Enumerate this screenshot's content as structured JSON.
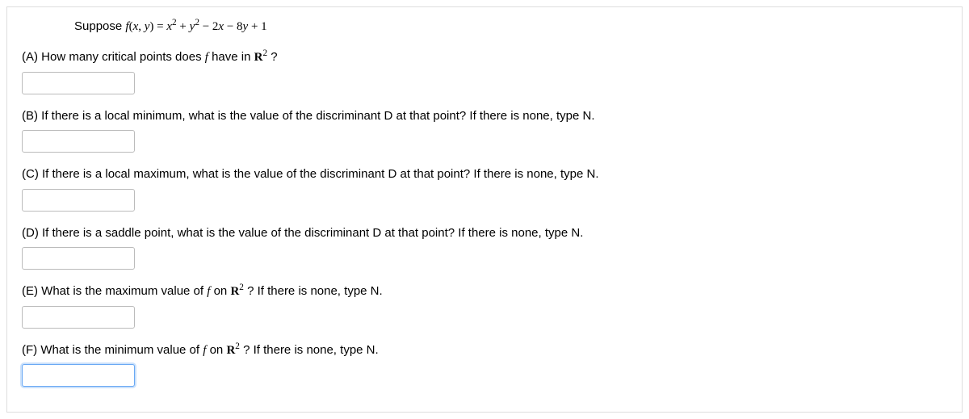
{
  "intro": {
    "prefix": "Suppose ",
    "func_left": "f",
    "paren_open": "(",
    "var_x": "x",
    "comma": ", ",
    "var_y": "y",
    "paren_close": ") = ",
    "term1_base": "x",
    "term1_exp": "2",
    "plus1": " + ",
    "term2_base": "y",
    "term2_exp": "2",
    "minus1": " − 2",
    "term3_var": "x",
    "minus2": " − 8",
    "term4_var": "y",
    "plus2": " + 1"
  },
  "questions": {
    "A": {
      "label": "(A) How many critical points does ",
      "f": "f",
      "mid": " have in ",
      "R": "R",
      "exp": "2",
      "end": " ?"
    },
    "B": {
      "text": "(B) If there is a local minimum, what is the value of the discriminant D at that point? If there is none, type N."
    },
    "C": {
      "text": "(C) If there is a local maximum, what is the value of the discriminant D at that point? If there is none, type N."
    },
    "D": {
      "text": "(D) If there is a saddle point, what is the value of the discriminant D at that point? If there is none, type N."
    },
    "E": {
      "label": "(E) What is the maximum value of ",
      "f": "f",
      "mid": " on ",
      "R": "R",
      "exp": "2",
      "end": " ? If there is none, type N."
    },
    "F": {
      "label": "(F) What is the minimum value of ",
      "f": "f",
      "mid": " on ",
      "R": "R",
      "exp": "2",
      "end": " ? If there is none, type N."
    }
  },
  "answers": {
    "A": "",
    "B": "",
    "C": "",
    "D": "",
    "E": "",
    "F": ""
  }
}
